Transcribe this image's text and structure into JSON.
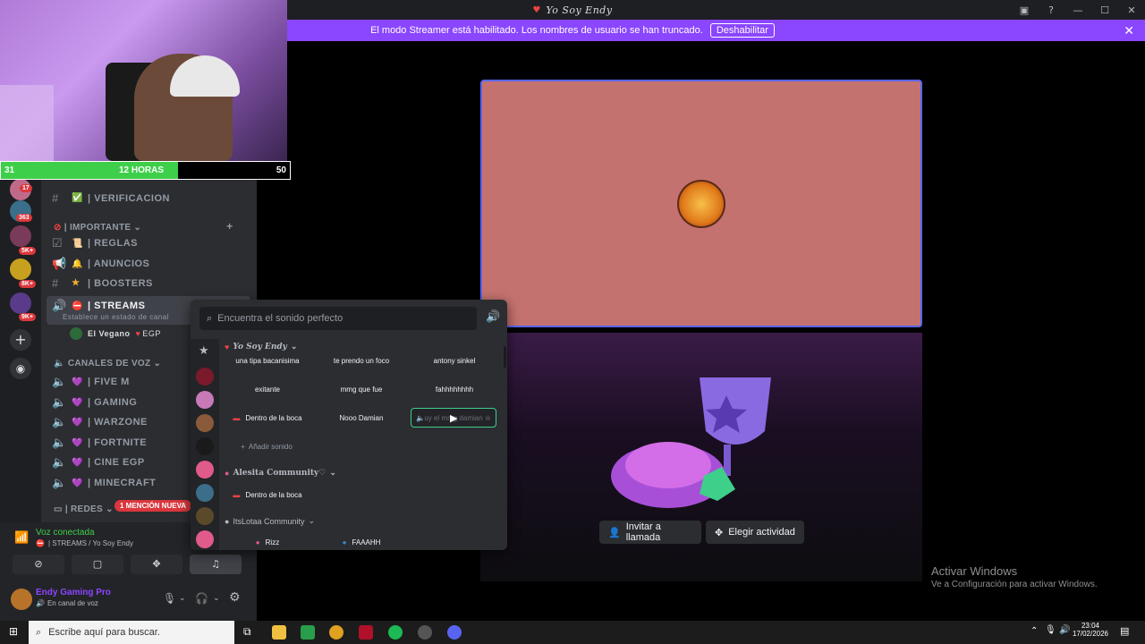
{
  "window": {
    "title": "Yo Soy Endy",
    "buttons": [
      "—",
      "☐",
      "✕"
    ]
  },
  "streamer_banner": {
    "text": "El modo Streamer está habilitado. Los nombres de usuario se han truncado.",
    "button": "Deshabilitar"
  },
  "stream_overlay": {
    "left_count": "31",
    "center_label": "12 HORAS",
    "right_count": "50"
  },
  "servers": {
    "badges": [
      "17",
      "363",
      "5K+",
      "8K+",
      "9K+"
    ]
  },
  "channels": {
    "items": [
      {
        "label": "| VERIFICACION"
      },
      {
        "category": "| IMPORTANTE"
      },
      {
        "label": "| REGLAS"
      },
      {
        "label": "| ANUNCIOS"
      },
      {
        "label": "| BOOSTERS"
      },
      {
        "label": "| STREAMS",
        "status": "Establece un estado de canal"
      },
      {
        "voice_user": "El Vegano",
        "tag": "EGP"
      },
      {
        "category": "CANALES DE VOZ"
      },
      {
        "label": "| FIVE M"
      },
      {
        "label": "| GAMING"
      },
      {
        "label": "| WARZONE"
      },
      {
        "label": "| FORTNITE"
      },
      {
        "label": "| CINE EGP"
      },
      {
        "label": "| MINECRAFT"
      },
      {
        "category": "| REDES"
      }
    ],
    "mention_pill": "1 MENCIÓN NUEVA"
  },
  "voice": {
    "status": "Voz conectada",
    "channel": "| STREAMS / Yo Soy Endy"
  },
  "user": {
    "name": "Endy Gaming Pro",
    "status": "En canal de voz"
  },
  "soundboard": {
    "search_placeholder": "Encuentra el sonido perfecto",
    "groups": [
      {
        "name": "Yo Soy Endy",
        "sounds": [
          "una tipa bacanisima",
          "te prendo un foco",
          "antony sinkel",
          "exitante",
          "mmg que fue",
          "fahhhhhhhh",
          "Dentro de la boca",
          "Nooo Damian",
          "uy el mmg damian"
        ],
        "add": "Añadir sonido"
      },
      {
        "name": "Alesita Community♡",
        "sounds": [
          "Dentro de la boca"
        ]
      },
      {
        "name": "ItsLotaa Community",
        "sounds": [
          "Rizz",
          "FAAAHH"
        ]
      }
    ]
  },
  "actions": {
    "invite": "Invitar a llamada",
    "activity": "Elegir actividad"
  },
  "watermark": {
    "title": "Activar Windows",
    "subtitle": "Ve a Configuración para activar Windows."
  },
  "taskbar": {
    "search_placeholder": "Escribe aquí para buscar.",
    "time": "23:04",
    "date": "17/02/2026"
  },
  "colors": {
    "accent": "#5865f2",
    "streamer": "#8b46ff",
    "stage": "#c4726f"
  }
}
